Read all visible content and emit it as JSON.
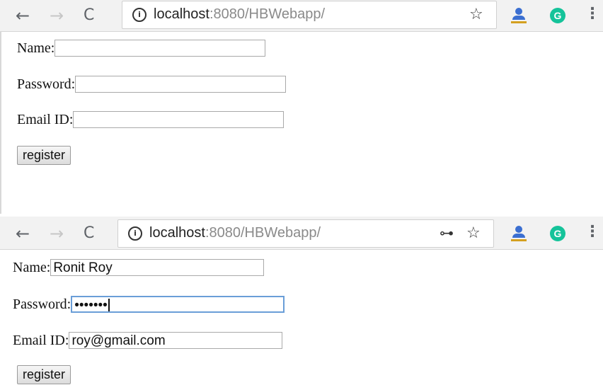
{
  "top": {
    "toolbar": {
      "back_icon": "←",
      "forward_icon": "→",
      "reload_icon": "C",
      "info_icon": "i",
      "url_host": "localhost",
      "url_rest": ":8080/HBWebapp/",
      "star_icon": "☆",
      "grammarly_label": "G",
      "menu_icon": "⋮"
    },
    "form": {
      "name_label": "Name:",
      "name_value": "",
      "password_label": "Password:",
      "password_value": "",
      "email_label": "Email ID:",
      "email_value": "",
      "register_label": "register"
    }
  },
  "bottom": {
    "toolbar": {
      "back_icon": "←",
      "forward_icon": "→",
      "reload_icon": "C",
      "info_icon": "i",
      "url_host": "localhost",
      "url_rest": ":8080/HBWebapp/",
      "key_icon": "⊶",
      "star_icon": "☆",
      "grammarly_label": "G",
      "menu_icon": "⋮"
    },
    "form": {
      "name_label": "Name:",
      "name_value": "Ronit Roy",
      "password_label": "Password:",
      "password_value": "•••••••",
      "email_label": "Email ID:",
      "email_value": "roy@gmail.com",
      "register_label": "register"
    }
  },
  "colors": {
    "toolbar_bg": "#f2f2f2",
    "url_gray": "#8a8a8a",
    "focus_border": "#6a9ed8",
    "grammarly_green": "#15c39a",
    "account_blue": "#3b6fd1"
  }
}
